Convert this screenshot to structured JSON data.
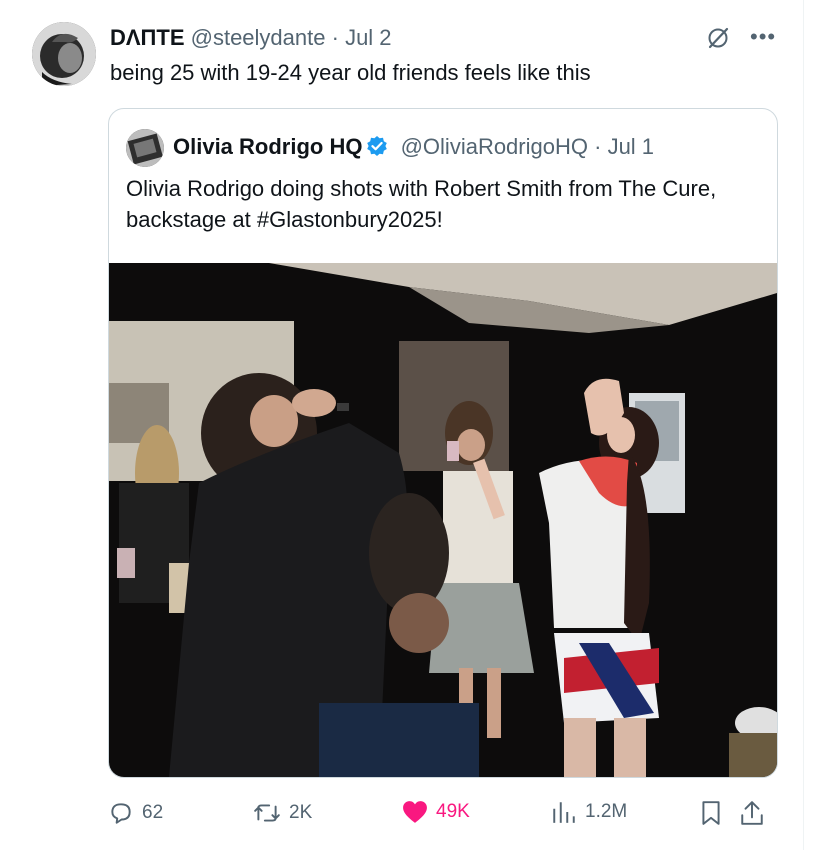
{
  "tweet": {
    "author_name": "DΛПTE",
    "author_handle": "@steelydante",
    "separator": "·",
    "date": "Jul 2",
    "text": "being 25 with 19-24 year old friends feels like this"
  },
  "quoted_tweet": {
    "author_name": "Olivia Rodrigo HQ",
    "author_handle": "@OliviaRodrigoHQ",
    "separator": "·",
    "date": "Jul 1",
    "text": "Olivia Rodrigo doing shots with Robert Smith from The Cure, backstage at #Glastonbury2025!"
  },
  "actions": {
    "replies": "62",
    "reposts": "2K",
    "likes": "49K",
    "views": "1.2M"
  },
  "colors": {
    "accent": "#1d9bf0",
    "like": "#f91880",
    "muted": "#536471"
  },
  "icons": [
    "grok-icon",
    "more-icon",
    "verified-badge-icon",
    "reply-icon",
    "repost-icon",
    "like-icon",
    "views-icon",
    "bookmark-icon",
    "share-icon"
  ]
}
